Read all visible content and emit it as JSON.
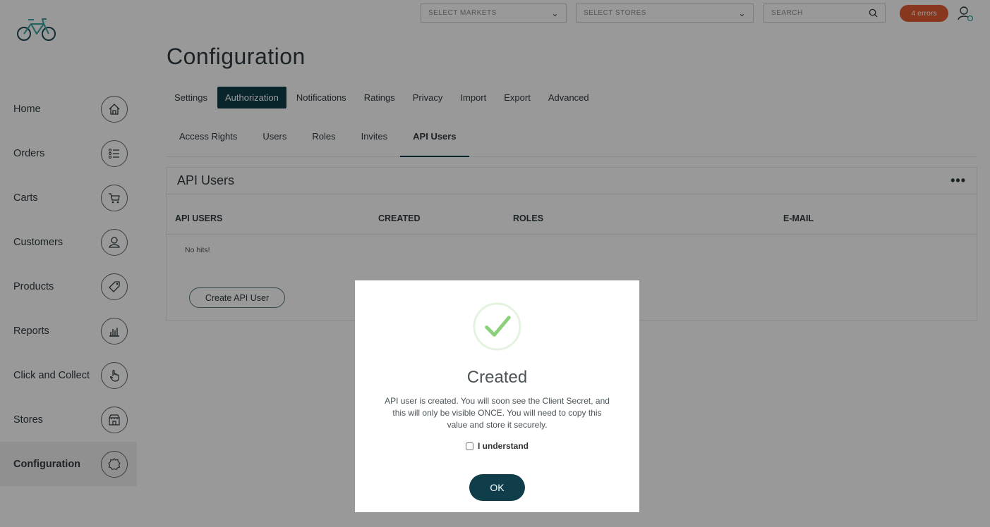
{
  "sidebar": {
    "items": [
      {
        "label": "Home",
        "icon": "home-icon"
      },
      {
        "label": "Orders",
        "icon": "list-icon"
      },
      {
        "label": "Carts",
        "icon": "cart-icon"
      },
      {
        "label": "Customers",
        "icon": "customer-icon"
      },
      {
        "label": "Products",
        "icon": "tag-icon"
      },
      {
        "label": "Reports",
        "icon": "bar-chart-icon"
      },
      {
        "label": "Click and Collect",
        "icon": "hand-pointer-icon"
      },
      {
        "label": "Stores",
        "icon": "store-icon"
      },
      {
        "label": "Configuration",
        "icon": "gear-icon"
      }
    ],
    "active": "Configuration"
  },
  "topbar": {
    "markets_placeholder": "SELECT MARKETS",
    "stores_placeholder": "SELECT STORES",
    "search_placeholder": "SEARCH",
    "errors_badge": "4 errors"
  },
  "page": {
    "title": "Configuration",
    "tabs": [
      "Settings",
      "Authorization",
      "Notifications",
      "Ratings",
      "Privacy",
      "Import",
      "Export",
      "Advanced"
    ],
    "active_tab": "Authorization",
    "subtabs": [
      "Access Rights",
      "Users",
      "Roles",
      "Invites",
      "API Users"
    ],
    "active_subtab": "API Users"
  },
  "card": {
    "title": "API Users",
    "columns": [
      "API USERS",
      "CREATED",
      "ROLES",
      "E-MAIL"
    ],
    "empty_text": "No hits!",
    "create_button": "Create API User"
  },
  "modal": {
    "title": "Created",
    "message": "API user is created. You will soon see the Client Secret, and this will only be visible ONCE. You will need to copy this value and store it securely.",
    "checkbox_label": "I understand",
    "ok_label": "OK"
  },
  "colors": {
    "accent": "#0f3e4a",
    "error_badge": "#e35c35",
    "success": "#8bd17c"
  }
}
